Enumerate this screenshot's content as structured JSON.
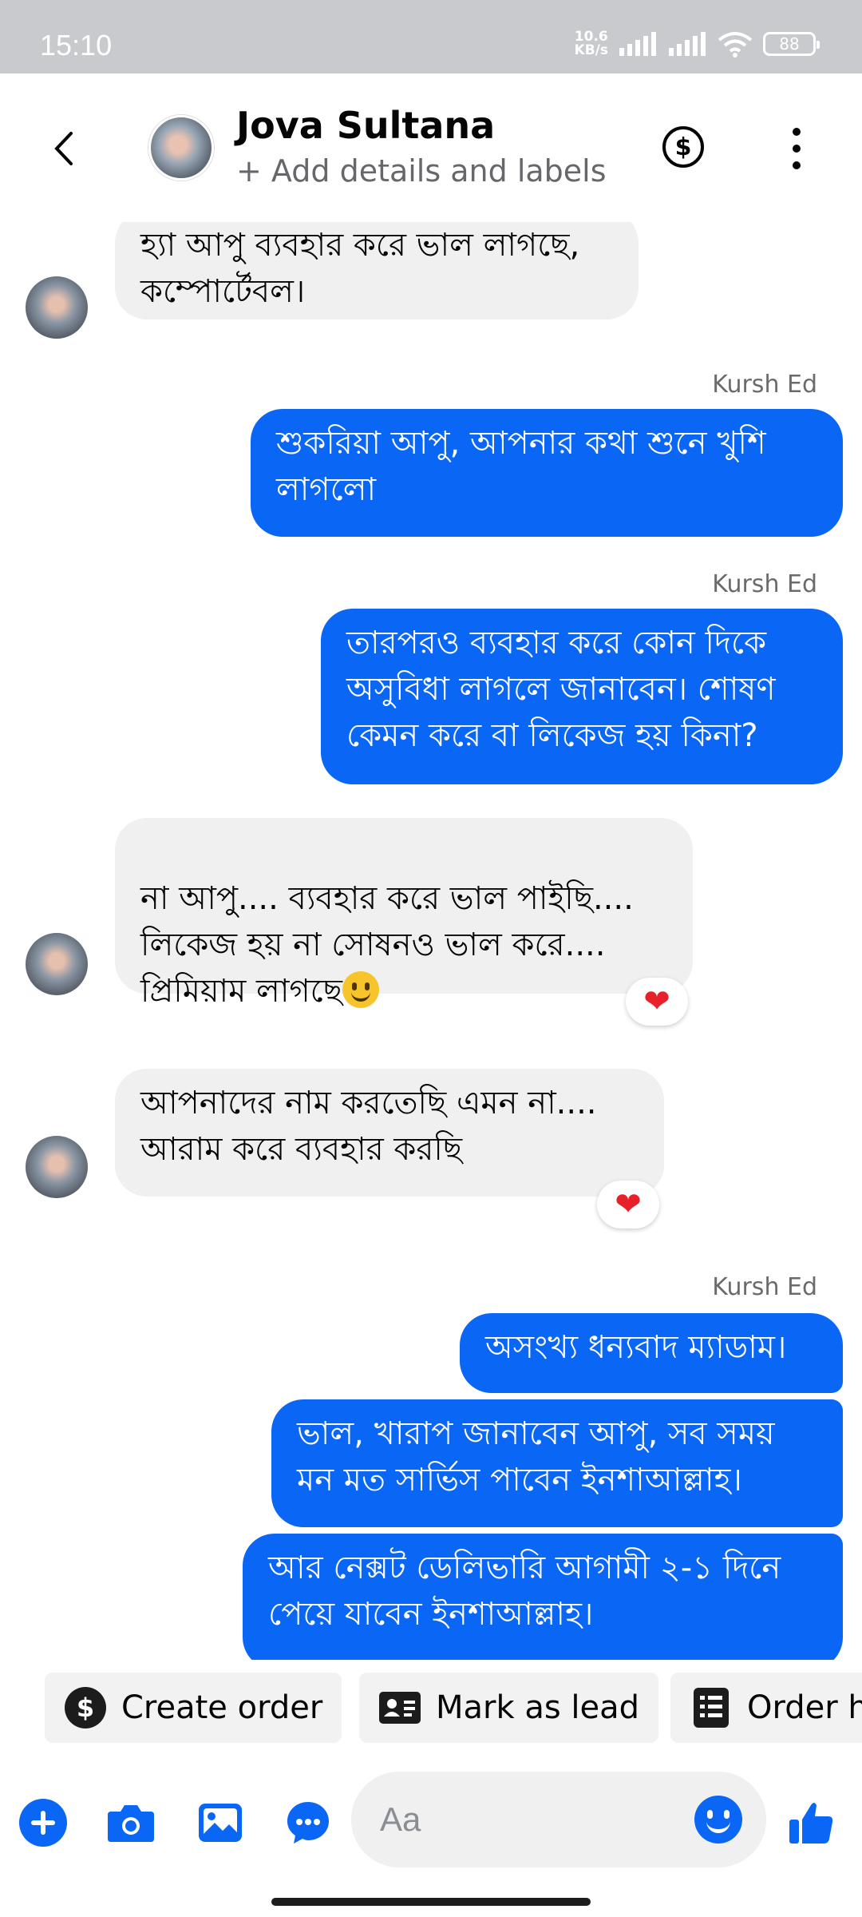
{
  "status_bar": {
    "time": "15:10",
    "net_speed_value": "10.6",
    "net_speed_unit": "KB/s",
    "battery": "88"
  },
  "header": {
    "contact_name": "Jova Sultana",
    "subtitle": "+ Add details and labels",
    "dollar_symbol": "$"
  },
  "messages": [
    {
      "direction": "incoming",
      "text": "হ্যা আপু ব্যবহার করে ভাল লাগছে,\nকম্পোর্টেবল।"
    },
    {
      "direction": "outgoing",
      "sender": "Kursh Ed",
      "text": "শুকরিয়া আপু, আপনার কথা শুনে খুশি\nলাগলো"
    },
    {
      "direction": "outgoing",
      "sender": "Kursh Ed",
      "text": "তারপরও ব্যবহার করে কোন দিকে\nঅসুবিধা লাগলে জানাবেন। শোষণ\nকেমন করে বা লিকেজ হয় কিনা?"
    },
    {
      "direction": "incoming",
      "text": "না আপু.... ব্যবহার করে ভাল পাইছি....\nলিকেজ হয় না সোষনও ভাল করে....\nপ্রিমিয়াম লাগছে",
      "reaction": "heart"
    },
    {
      "direction": "incoming",
      "text": "আপনাদের নাম করতেছি এমন না....\nআরাম করে ব্যবহার করছি",
      "reaction": "heart"
    },
    {
      "direction": "outgoing",
      "sender": "Kursh Ed",
      "text": "অসংখ্য ধন্যবাদ ম্যাডাম।"
    },
    {
      "direction": "outgoing",
      "text": "ভাল, খারাপ জানাবেন আপু, সব সময়\nমন মত সার্ভিস পাবেন ইনশাআল্লাহ।"
    },
    {
      "direction": "outgoing",
      "text": "আর নেক্সট ডেলিভারি আগামী ২-১ দিনে\nপেয়ে যাবেন ইনশাআল্লাহ।"
    }
  ],
  "quick_actions": {
    "create_order": "Create order",
    "mark_as_lead": "Mark as lead",
    "order_history": "Order h"
  },
  "composer": {
    "placeholder": "Aa"
  },
  "colors": {
    "accent": "#0a66f5",
    "incoming_bubble": "#f0f0f0",
    "reaction": "#e8202a"
  }
}
